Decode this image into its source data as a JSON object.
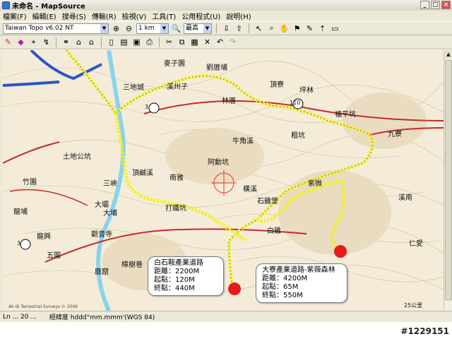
{
  "window": {
    "title": "未命名 - MapSource",
    "min": "_",
    "max": "□",
    "close": "×"
  },
  "menu": [
    "檔案(F)",
    "編輯(E)",
    "搜尋(S)",
    "傳輸(R)",
    "檢視(V)",
    "工具(T)",
    "公用程式(U)",
    "說明(H)"
  ],
  "toolbar": {
    "map_product": "Taiwan Topo v6.02 NT",
    "scale": "1 km",
    "detail": "最高"
  },
  "map": {
    "labels": [
      "麥子園",
      "劉厝埔",
      "溪州子",
      "三地城",
      "林厝",
      "頂寮",
      "坪林",
      "福平坑",
      "九寮",
      "粗坑",
      "阿勳坑",
      "頂鹹溪",
      "橫溪",
      "土地公坑",
      "竹園",
      "大埔",
      "龍興",
      "五圍",
      "觀音寺",
      "南雅",
      "牛角溪",
      "石雞堡",
      "三峽",
      "白雞",
      "紫微",
      "溪南",
      "仁愛",
      "打鐵坑",
      "大壩",
      "龍埔",
      "樟樹巷",
      "鹿窟"
    ],
    "scale_text": "25公里",
    "copyright": "Ah Ib Terrestrial Surveys © 2009",
    "road_numbers": [
      "3",
      "110",
      "3"
    ]
  },
  "callouts": [
    {
      "title": "白石鞍產業道路",
      "distance": "距離：2200M",
      "start": "起點：120M",
      "end": "終點：440M"
    },
    {
      "title": "大寮產業道路-紫薇森林",
      "distance": "距離：4200M",
      "start": "起點：65M",
      "end": "終點：550M"
    }
  ],
  "status": {
    "left": "Ln ... 20 ...",
    "format": "經緯度 hddd°mm.mmm'(WGS 84)"
  },
  "watermark": "#1229151",
  "colors": {
    "route": "#f5f01e",
    "marker": "#e8191d",
    "highway": "#2a56c6",
    "river": "#8ad3ec",
    "road_red": "#c72a2a",
    "map_bg": "#f4ecd8"
  }
}
